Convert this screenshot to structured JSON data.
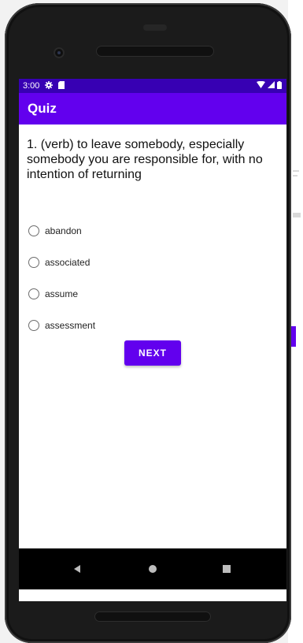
{
  "status_bar": {
    "time": "3:00",
    "icons": [
      "settings-icon",
      "sd-card-icon",
      "wifi-icon",
      "signal-icon",
      "battery-icon"
    ]
  },
  "app_bar": {
    "title": "Quiz"
  },
  "quiz": {
    "question": "1. (verb) to leave somebody, especially somebody you are responsible for, with no intention of returning",
    "options": [
      {
        "label": "abandon",
        "selected": false
      },
      {
        "label": "associated",
        "selected": false
      },
      {
        "label": "assume",
        "selected": false
      },
      {
        "label": "assessment",
        "selected": false
      }
    ],
    "next_label": "NEXT"
  },
  "nav_bar": {
    "icons": [
      "back-icon",
      "home-icon",
      "recents-icon"
    ]
  },
  "colors": {
    "primary": "#6200ee",
    "primary_dark": "#3700b3",
    "background": "#ffffff"
  }
}
